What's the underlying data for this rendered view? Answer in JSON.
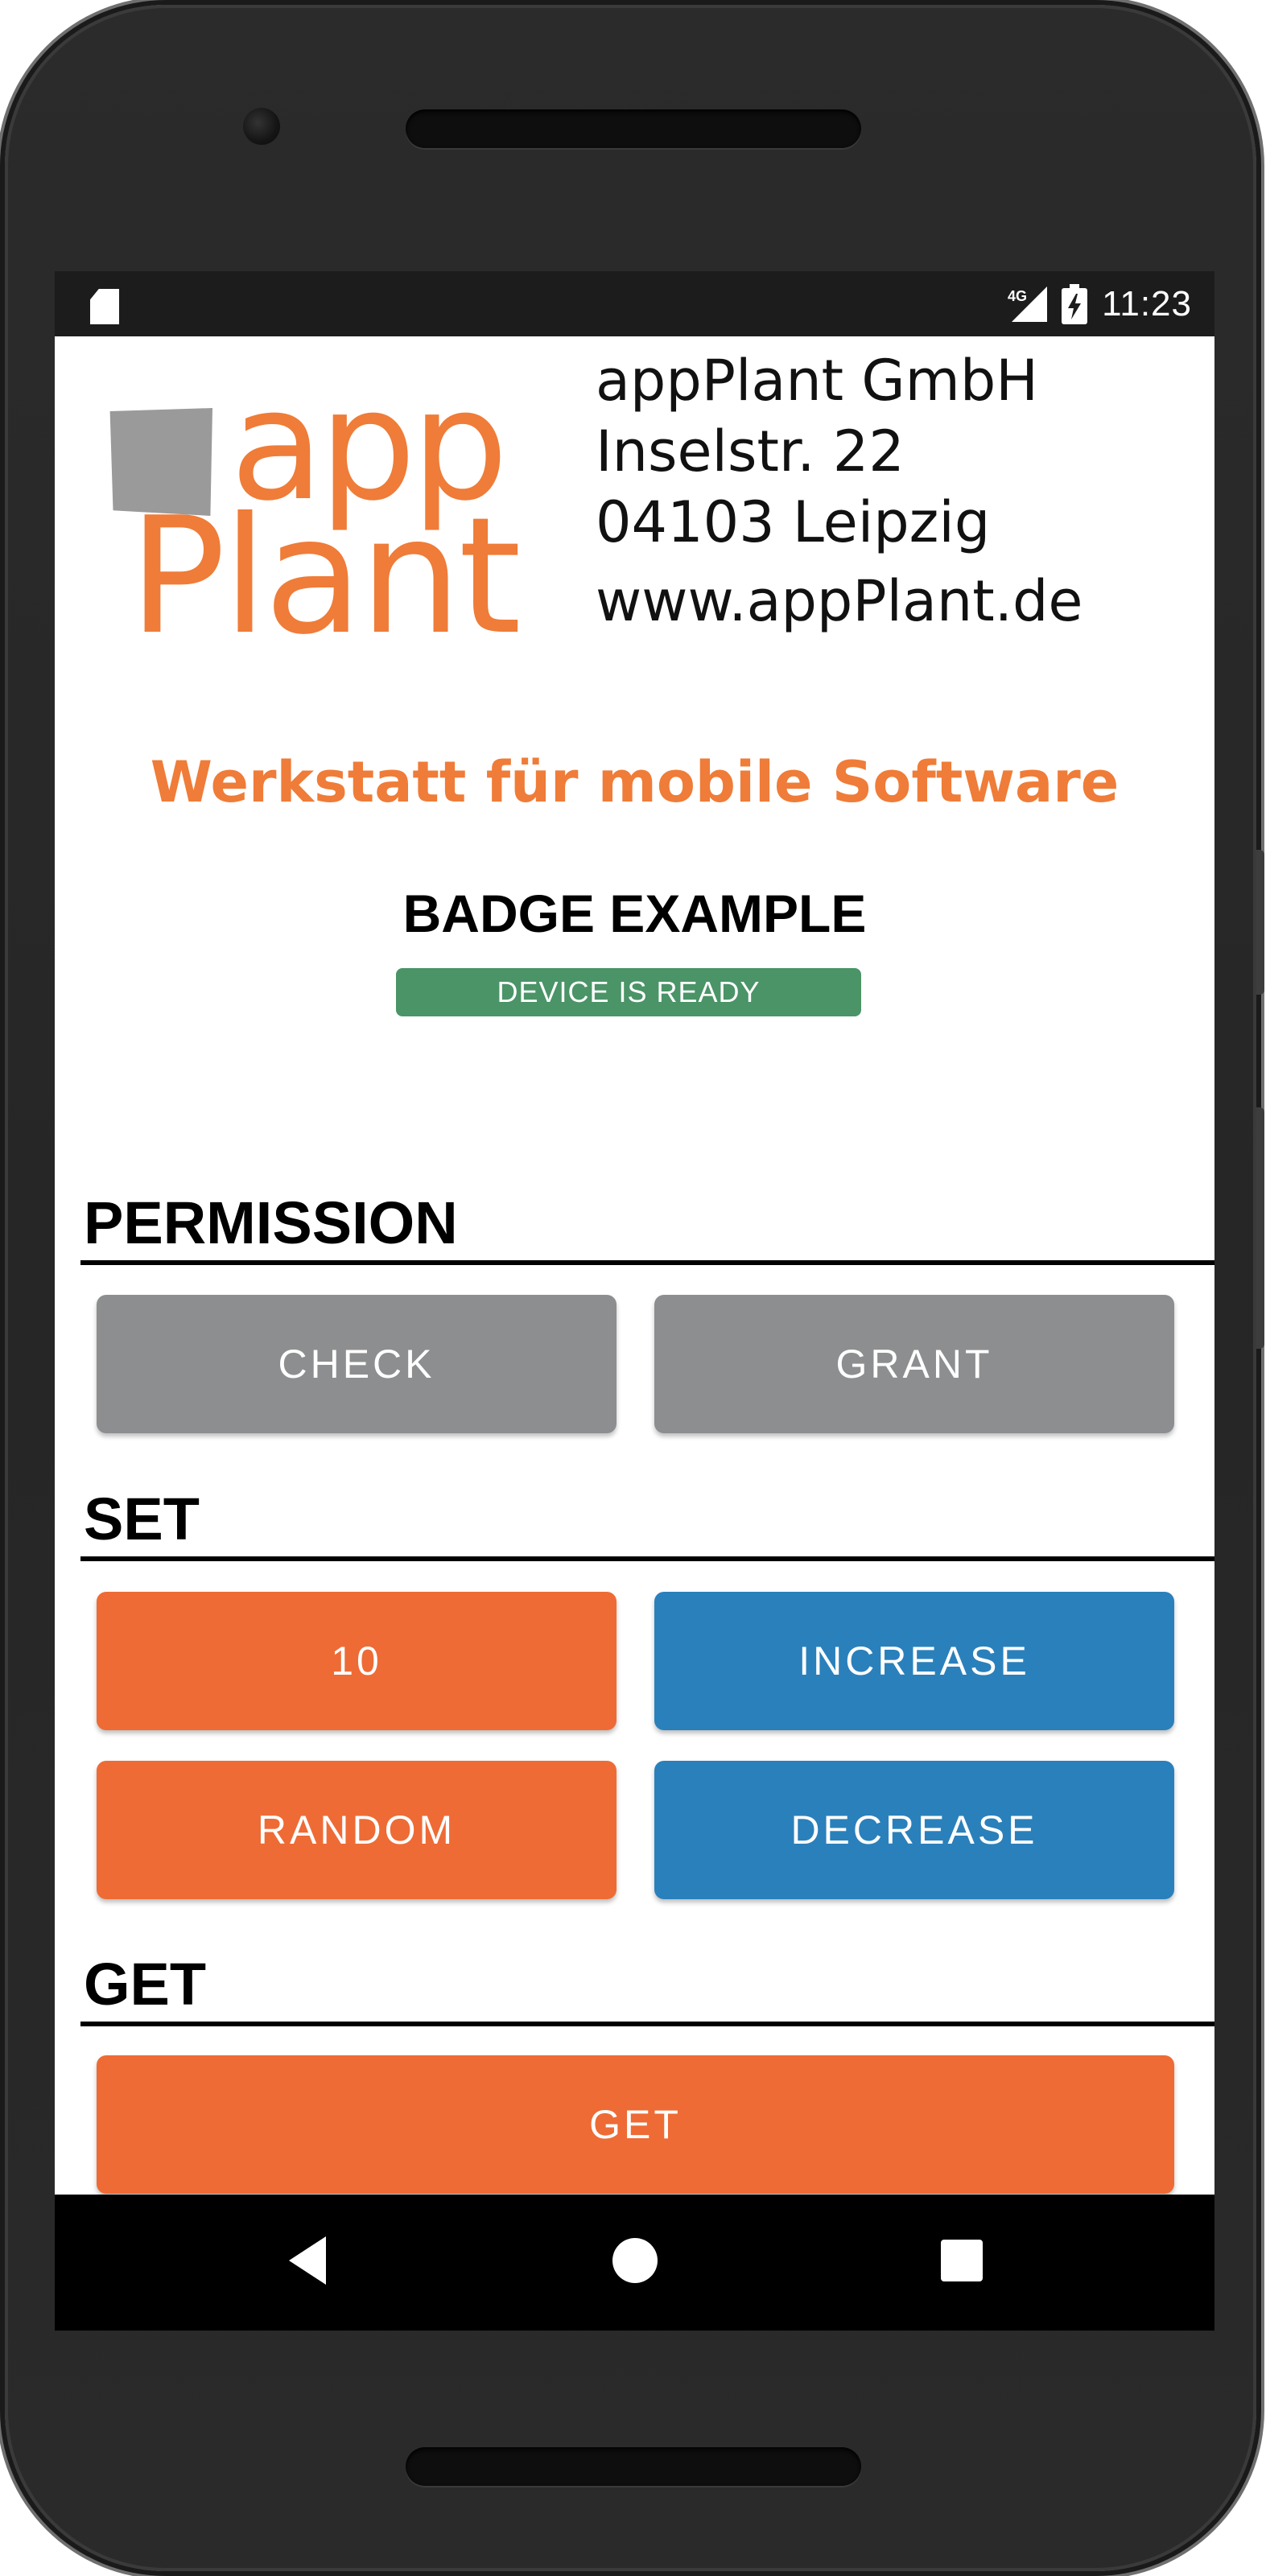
{
  "status_bar": {
    "time": "11:23",
    "network": "4G",
    "icons": [
      "sd-card-icon",
      "signal-icon",
      "battery-charging-icon"
    ]
  },
  "header": {
    "logo_word_1": "app",
    "logo_word_2": "Plant",
    "address_lines": [
      "appPlant GmbH",
      "Inselstr. 22",
      "04103 Leipzig",
      "www.appPlant.de"
    ],
    "tagline": "Werkstatt für mobile Software"
  },
  "badge": {
    "title": "BADGE EXAMPLE",
    "status": "DEVICE IS READY"
  },
  "sections": {
    "permission": {
      "title": "PERMISSION",
      "buttons": [
        "CHECK",
        "GRANT"
      ]
    },
    "set": {
      "title": "SET",
      "buttons": [
        "10",
        "INCREASE",
        "RANDOM",
        "DECREASE"
      ]
    },
    "get": {
      "title": "GET",
      "buttons": [
        "GET"
      ]
    }
  },
  "nav_bar": {
    "icons": [
      "back-icon",
      "home-icon",
      "recents-icon"
    ]
  },
  "colors": {
    "brand_orange": "#ef7c38",
    "button_orange": "#ee6b35",
    "button_blue": "#2a80bb",
    "button_gray": "#8c8e90",
    "badge_green": "#4a9467",
    "logo_gray": "#9a9a9a"
  }
}
